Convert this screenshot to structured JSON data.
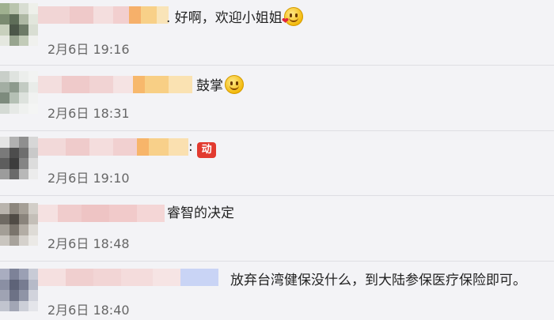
{
  "comments": [
    {
      "text": ". 好啊，欢迎小姐姐",
      "emoji": "kiss-heart-emoji",
      "time": "2月6日 19:16"
    },
    {
      "text": "鼓掌",
      "emoji": "clapping-smile-emoji",
      "time": "2月6日 18:31"
    },
    {
      "text": ":",
      "badge": "动",
      "time": "2月6日 19:10"
    },
    {
      "text": "睿智的决定",
      "time": "2月6日 18:48"
    },
    {
      "text": "放弃台湾健保没什么，到大陆参保医疗保险即可。",
      "time": "2月6日 18:40"
    }
  ],
  "colors": {
    "background": "#f3f3f6",
    "divider": "#dedee3",
    "time_text": "#666666",
    "badge": "#e23a2f"
  }
}
